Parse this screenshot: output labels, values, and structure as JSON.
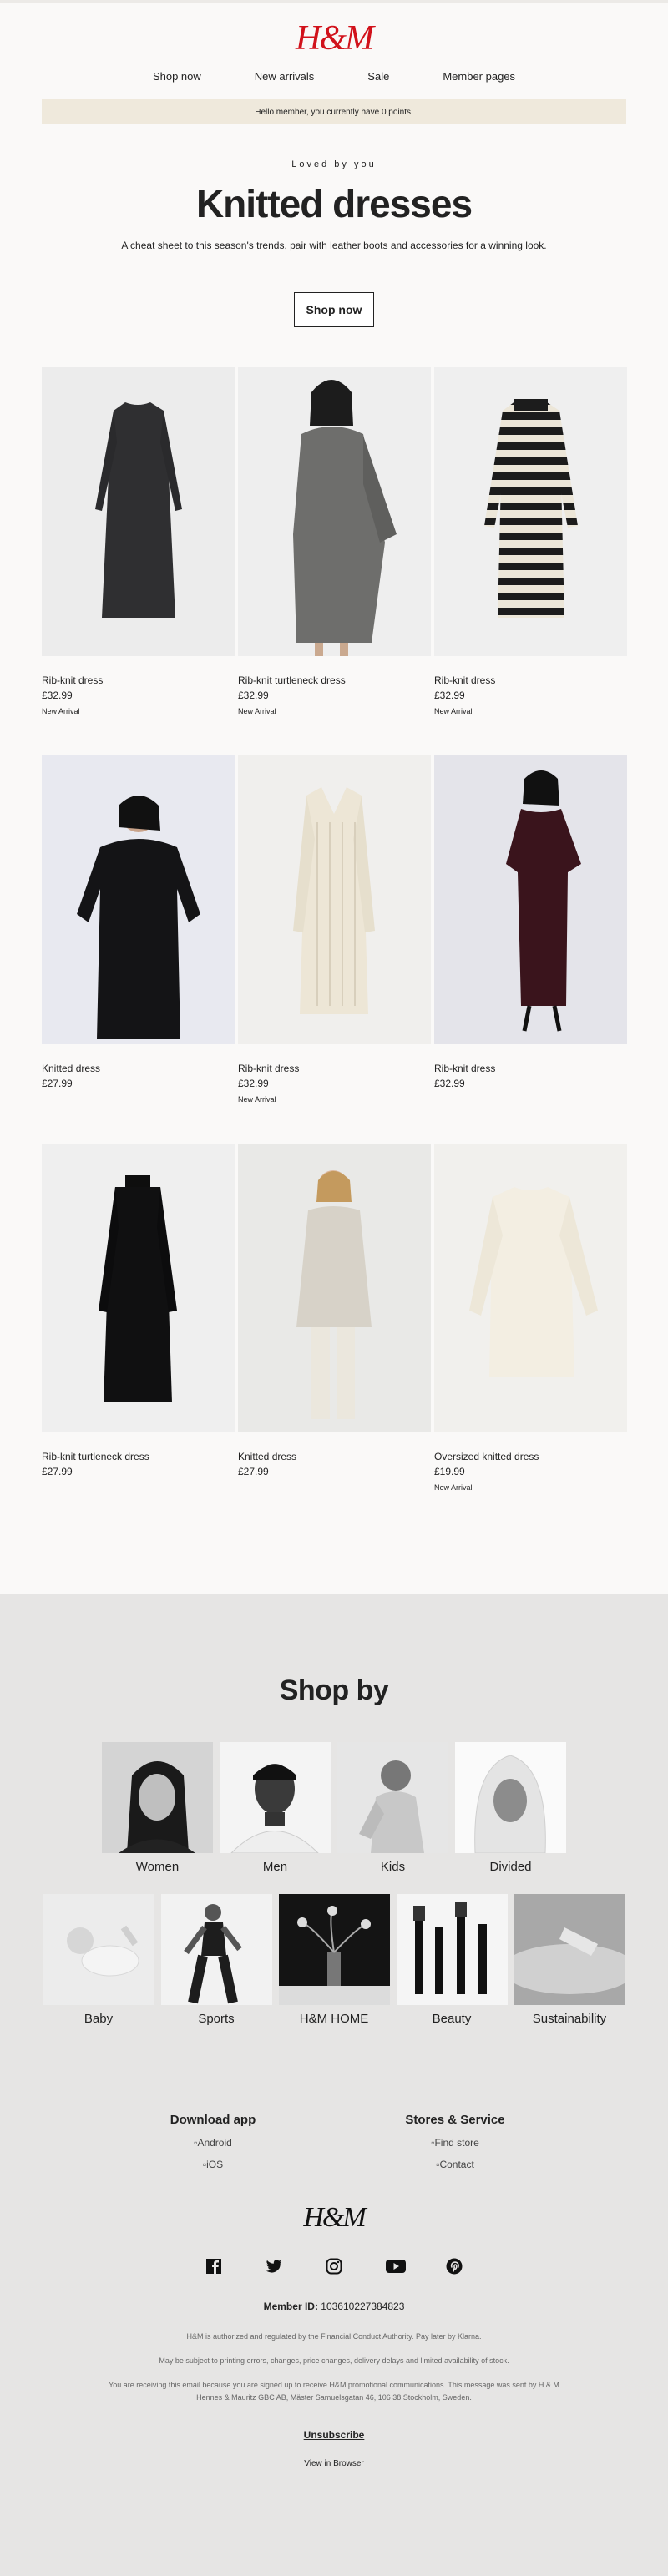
{
  "brand": {
    "logo": "H&M"
  },
  "nav": [
    {
      "label": "Shop now"
    },
    {
      "label": "New arrivals"
    },
    {
      "label": "Sale"
    },
    {
      "label": "Member pages"
    }
  ],
  "banner": {
    "text": "Hello member, you currently have 0 points."
  },
  "hero": {
    "eyebrow": "Loved by you",
    "title": "Knitted dresses",
    "lead": "A cheat sheet to this season's trends, pair with leather boots and accessories for a winning look.",
    "cta": "Shop now"
  },
  "products": [
    {
      "name": "Rib-knit dress",
      "price": "£32.99",
      "tag": "New Arrival"
    },
    {
      "name": "Rib-knit turtleneck dress",
      "price": "£32.99",
      "tag": "New Arrival"
    },
    {
      "name": "Rib-knit dress",
      "price": "£32.99",
      "tag": "New Arrival"
    },
    {
      "name": "Knitted dress",
      "price": "£27.99",
      "tag": ""
    },
    {
      "name": "Rib-knit dress",
      "price": "£32.99",
      "tag": "New Arrival"
    },
    {
      "name": "Rib-knit dress",
      "price": "£32.99",
      "tag": ""
    },
    {
      "name": "Rib-knit turtleneck dress",
      "price": "£27.99",
      "tag": ""
    },
    {
      "name": "Knitted dress",
      "price": "£27.99",
      "tag": ""
    },
    {
      "name": "Oversized knitted dress",
      "price": "£19.99",
      "tag": "New Arrival"
    }
  ],
  "shopby": {
    "title": "Shop by",
    "row1": [
      {
        "label": "Women"
      },
      {
        "label": "Men"
      },
      {
        "label": "Kids"
      },
      {
        "label": "Divided"
      }
    ],
    "row2": [
      {
        "label": "Baby"
      },
      {
        "label": "Sports"
      },
      {
        "label": "H&M HOME"
      },
      {
        "label": "Beauty"
      },
      {
        "label": "Sustainability"
      }
    ]
  },
  "footer": {
    "download_title": "Download app",
    "android": "Android",
    "ios": "iOS",
    "stores_title": "Stores & Service",
    "find_store": "Find store",
    "contact": "Contact",
    "logo": "H&M",
    "member_label": "Member ID:",
    "member_id": "103610227384823",
    "fine1": "H&M is authorized and regulated by the Financial Conduct Authority. Pay later by Klarna.",
    "fine2": "May be subject to printing errors, changes, price changes, delivery delays and limited availability of stock.",
    "fine3": "You are receiving this email because you are signed up to receive H&M promotional communications. This message was sent by H & M Hennes & Mauritz GBC AB, Mäster Samuelsgatan 46, 106 38 Stockholm, Sweden.",
    "unsubscribe": "Unsubscribe",
    "view_browser": "View in Browser"
  },
  "social": [
    "facebook-icon",
    "twitter-icon",
    "instagram-icon",
    "youtube-icon",
    "pinterest-icon"
  ]
}
